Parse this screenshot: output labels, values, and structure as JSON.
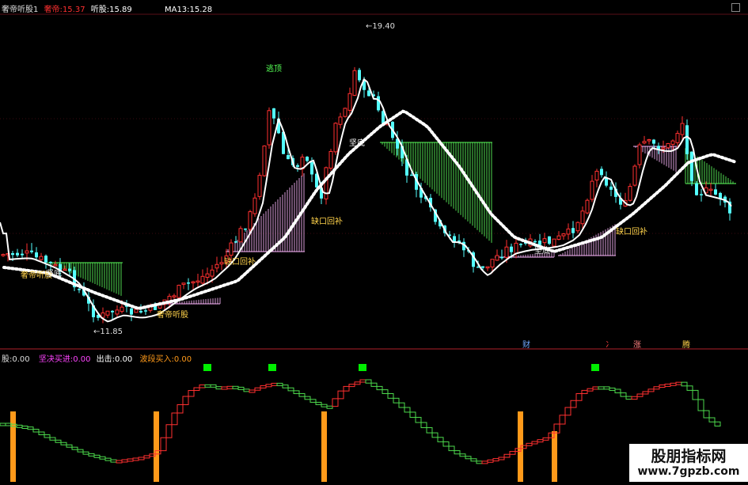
{
  "header": {
    "indicator_name": "奢帝听股1",
    "buy_label": "奢帝:",
    "buy_value": "15.37",
    "sell_label": "听股:",
    "sell_value": "15.89",
    "ma_label": "MA13:",
    "ma_value": "15.28"
  },
  "sub_header": {
    "item0": {
      "label": "股:",
      "value": "0.00"
    },
    "item1": {
      "label": "坚决买进:",
      "value": "0.00"
    },
    "item2": {
      "label": "出击:",
      "value": "0.00"
    },
    "item3": {
      "label": "波段买入:",
      "value": "0.00"
    }
  },
  "colors": {
    "background": "#000000",
    "up_candle": "#ff3030",
    "down_candle": "#54ffff",
    "ma_line": "#ffffff",
    "dotted_line": "#ffffff",
    "green_fill": "#5dff5d",
    "pink_fill": "#ffb8ff",
    "label_yellow": "#ffd24a",
    "label_green": "#55ff55",
    "sub_up": "#ff3030",
    "sub_down": "#4cd94c",
    "bar_orange": "#ff9a1a",
    "signal_green": "#00ee00"
  },
  "annotations": {
    "high_price": "19.40",
    "low_price": "11.85",
    "sell_signal": "逃顶",
    "buy_signal": "奢帝听股",
    "gap_back_a": "缺口回补",
    "gap_back_b": "缺口回补",
    "wave_bottom": "坚底",
    "mark_a": "财",
    "mark_b": "冫",
    "mark_c": "涨",
    "mark_d": "腾"
  },
  "watermark": {
    "title": "股朋指标网",
    "url": "www.7gpzb.com"
  },
  "chart_data": {
    "type": "candlestick",
    "y_range": [
      11.2,
      20.0
    ],
    "last_values": {
      "buy": 15.37,
      "sell": 15.89,
      "ma13": 15.28
    },
    "extremes": {
      "high": 19.4,
      "low": 11.85
    },
    "sub_chart": {
      "type": "stepped-line-with-bars",
      "y_range": [
        0,
        100
      ]
    }
  }
}
